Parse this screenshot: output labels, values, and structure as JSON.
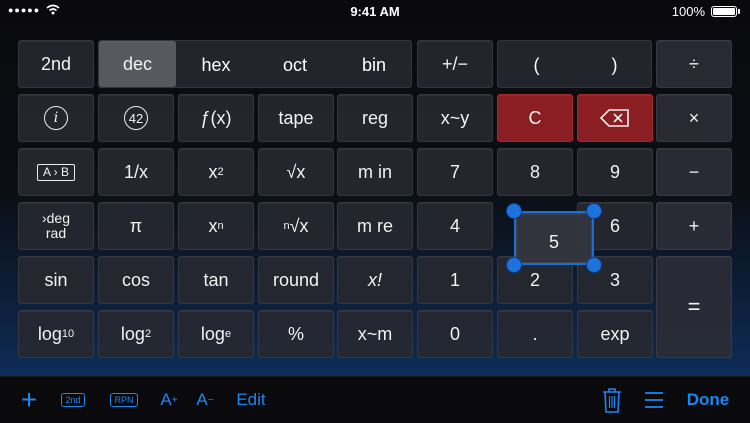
{
  "status": {
    "time": "9:41 AM",
    "battery": "100%"
  },
  "modes": [
    "dec",
    "hex",
    "oct",
    "bin"
  ],
  "active_mode": "dec",
  "keys": {
    "second": "2nd",
    "plus_minus": "+/−",
    "paren_open": "(",
    "paren_close": ")",
    "divide": "÷",
    "info": "i",
    "answer": "42",
    "fx": "ƒ(x)",
    "tape": "tape",
    "reg": "reg",
    "x_swap_y": "x~y",
    "clear": "C",
    "multiply": "×",
    "a_to_b": "A › B",
    "reciprocal": "1/x",
    "square": "x",
    "square_sup": "2",
    "sqrt": "√x",
    "m_in": "m in",
    "minus": "−",
    "deg": "›deg",
    "rad": "rad",
    "pi": "π",
    "power": "x",
    "power_sup": "n",
    "nth_root_sup": "n",
    "nth_root": "√x",
    "m_re": "m re",
    "plus": "+",
    "sin": "sin",
    "cos": "cos",
    "tan": "tan",
    "round": "round",
    "factorial": "x!",
    "log10_base": "log",
    "log10_sub": "10",
    "log2_base": "log",
    "log2_sub": "2",
    "loge_base": "log",
    "loge_sub": "e",
    "percent": "%",
    "x_swap_m": "x~m",
    "decimal": ".",
    "exp": "exp",
    "equals": "=",
    "d0": "0",
    "d1": "1",
    "d2": "2",
    "d3": "3",
    "d4": "4",
    "d5": "5",
    "d6": "6",
    "d7": "7",
    "d8": "8",
    "d9": "9"
  },
  "toolbar": {
    "add": "+",
    "second": "2nd",
    "rpn": "RPN",
    "font_up": "A",
    "font_up_sup": "+",
    "font_down": "A",
    "font_down_sup": "−",
    "edit": "Edit",
    "done": "Done"
  },
  "icons": [
    "wifi-icon",
    "battery-icon",
    "backspace-icon",
    "trash-icon",
    "menu-icon"
  ],
  "colors": {
    "accent": "#1e86f0",
    "clear_key": "#8a1e22",
    "selection": "#1a6fd6"
  }
}
